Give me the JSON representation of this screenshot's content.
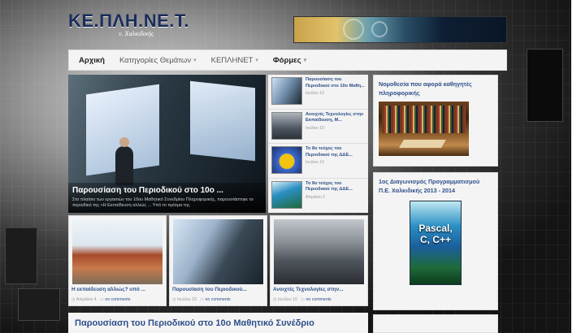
{
  "site": {
    "title": "ΚΕ.ΠΛΗ.ΝΕ.Τ.",
    "subtitle": "ν. Χαλκιδικής"
  },
  "nav": {
    "items": [
      {
        "label": "Αρχική",
        "active": true,
        "has_menu": false
      },
      {
        "label": "Κατηγορίες Θεμάτων",
        "active": false,
        "has_menu": true
      },
      {
        "label": "ΚΕΠΛΗΝΕΤ",
        "active": false,
        "has_menu": true
      },
      {
        "label": "Φόρμες",
        "active": false,
        "has_menu": true
      }
    ],
    "chevron": "▾"
  },
  "featured": {
    "title": "Παρουσίαση του Περιοδικού στο 10ο ...",
    "excerpt": "Στο πλαίσιο των εργασιών του 10ου Μαθητικό Συνεδρίου Πληροφορικής, παρουσιάστηκε το περιοδικό της «Η Εκπαίδευση αλλιώς ... Υπό το πρίσμα της"
  },
  "side_list": [
    {
      "title": "Παρουσίαση του Περιοδικού στο 10ο Μαθη...",
      "meta": "Ιουλίου 10"
    },
    {
      "title": "Ανοιχτές Τεχνολογίες στην Εκπαίδευση, Μ...",
      "meta": "Ιουλίου 10"
    },
    {
      "title": "Το 8ο τεύχος του Περιοδικού της ΔΔΕ...",
      "meta": "Ιουλίου 10"
    },
    {
      "title": "Το 8ο τεύχος του Περιοδικού της ΔΔΕ...",
      "meta": "Απριλίου 2"
    }
  ],
  "cards": [
    {
      "title": "Η εκπαίδευση αλλιώς? υπό ...",
      "date": "Απριλίου 4",
      "comments": "no comments"
    },
    {
      "title": "Παρουσίαση του Περιοδικού...",
      "date": "Ιουλίου 10",
      "comments": "no comments"
    },
    {
      "title": "Ανοιχτές Τεχνολογίες στην...",
      "date": "Ιουλίου 10",
      "comments": "no comments"
    }
  ],
  "post": {
    "title": "Παρουσίαση του Περιοδικού στο 10ο Μαθητικό Συνέδριο"
  },
  "widgets": [
    {
      "title": "Νομοθεσία που αφορά καθηγητές πληροφορικής"
    },
    {
      "title": "1ος Διαγωνισμός Προγραμματισμού Π.Ε. Χαλκιδικής 2013 - 2014",
      "image_text": "Pascal, C, C++"
    }
  ],
  "colors": {
    "link": "#2d4f8a",
    "logo": "#1a2c5a"
  }
}
